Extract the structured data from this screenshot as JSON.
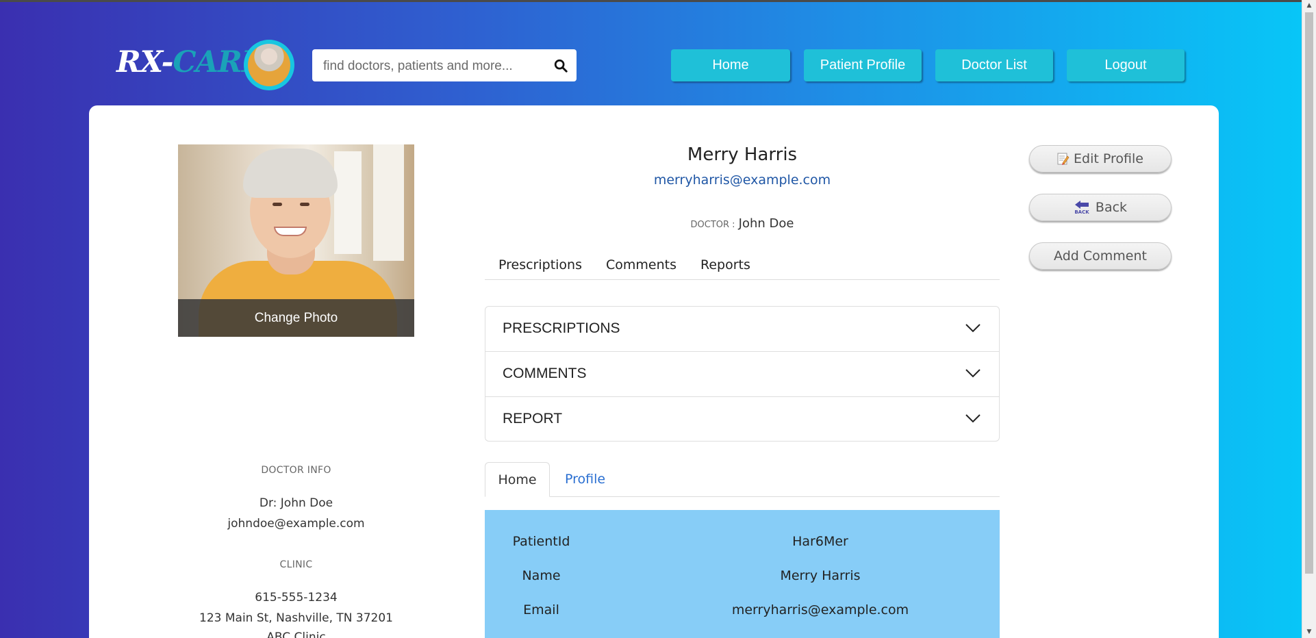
{
  "brand": {
    "part1": "RX-",
    "part2": "CARE"
  },
  "search": {
    "placeholder": "find doctors, patients and more..."
  },
  "nav": [
    {
      "label": "Home"
    },
    {
      "label": "Patient Profile"
    },
    {
      "label": "Doctor List"
    },
    {
      "label": "Logout"
    }
  ],
  "photo": {
    "change_label": "Change Photo"
  },
  "patient": {
    "name": "Merry Harris",
    "email": "merryharris@example.com",
    "doctor_label": "DOCTOR :",
    "doctor_name": "John Doe"
  },
  "tabs": [
    "Prescriptions",
    "Comments",
    "Reports"
  ],
  "accordion": [
    "PRESCRIPTIONS",
    "COMMENTS",
    "REPORT"
  ],
  "detail_tabs": {
    "active": "Home",
    "other": "Profile"
  },
  "details": [
    {
      "key": "PatientId",
      "value": "Har6Mer"
    },
    {
      "key": "Name",
      "value": "Merry Harris"
    },
    {
      "key": "Email",
      "value": "merryharris@example.com"
    }
  ],
  "doctor_info": {
    "heading": "DOCTOR INFO",
    "name": "Dr: John Doe",
    "email": "johndoe@example.com"
  },
  "clinic": {
    "heading": "CLINIC",
    "phone": "615-555-1234",
    "address": "123 Main St, Nashville, TN 37201",
    "name": "ABC Clinic"
  },
  "actions": {
    "edit": "Edit Profile",
    "back": "Back",
    "back_icon_text": "BACK",
    "comment": "Add Comment"
  },
  "colors": {
    "gradient_start": "#3a2fb0",
    "gradient_end": "#08c6f7",
    "nav_button": "#1fc0d8",
    "details_bg": "#87cdf7",
    "link": "#1f56a5"
  }
}
